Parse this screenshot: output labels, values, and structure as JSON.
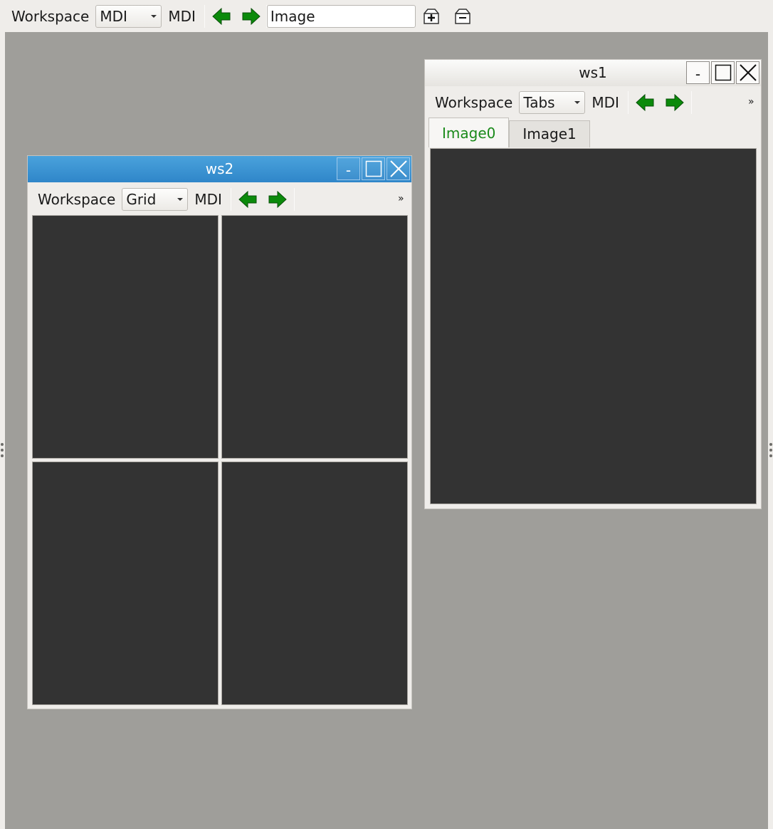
{
  "main_toolbar": {
    "workspace_label": "Workspace",
    "mode_value": "MDI",
    "mdi_label": "MDI",
    "image_input_value": "Image"
  },
  "windows": {
    "ws2": {
      "title": "ws2",
      "minimize_glyph": "-",
      "toolbar": {
        "workspace_label": "Workspace",
        "layout_value": "Grid",
        "mdi_label": "MDI",
        "overflow": "»"
      }
    },
    "ws1": {
      "title": "ws1",
      "minimize_glyph": "-",
      "toolbar": {
        "workspace_label": "Workspace",
        "layout_value": "Tabs",
        "mdi_label": "MDI",
        "overflow": "»"
      },
      "tabs": [
        {
          "label": "Image0"
        },
        {
          "label": "Image1"
        }
      ]
    }
  },
  "colors": {
    "mdi_background": "#9f9e9a",
    "image_pane": "#333333",
    "active_title": "#3792d1",
    "arrow_green": "#0b8a0b",
    "selected_tab_text": "#1a8a1a"
  },
  "icons": [
    "left-arrow-icon",
    "right-arrow-icon",
    "add-workspace-icon",
    "remove-workspace-icon",
    "minimize-icon",
    "maximize-icon",
    "close-icon"
  ]
}
